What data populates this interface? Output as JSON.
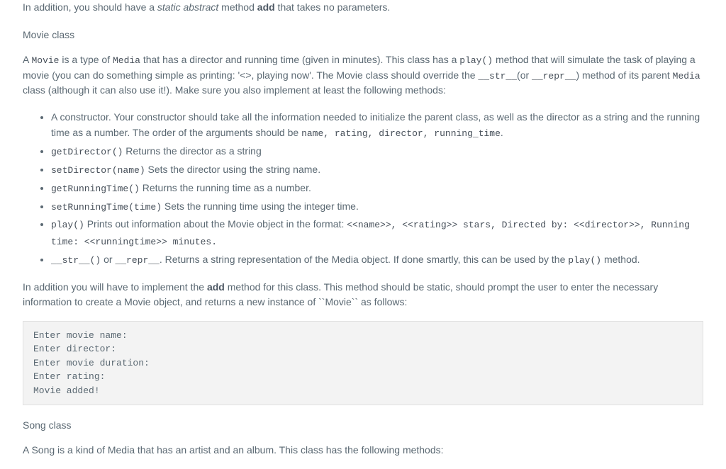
{
  "intro_line": "In addition, you should have a static abstract method add that takes no parameters.",
  "movie": {
    "heading": "Movie class",
    "p1": {
      "t0": "A ",
      "c0": "Movie",
      "t1": " is a type of ",
      "c1": "Media",
      "t2": " that has a director and running time (given in minutes). This class has a ",
      "c2": "play()",
      "t3": " method that will simulate the task of playing a movie (you can do something simple as printing: '<>, playing now'. The Movie class should override the ",
      "c3": "__str__",
      "t4": "(or ",
      "c4": "__repr__",
      "t5": ") method of its parent ",
      "c5": "Media",
      "t6": " class (although it can also use it!). Make sure you also implement at least the following methods:"
    },
    "bullets": [
      {
        "t0": "A constructor. Your constructor should take all the information needed to initialize the parent class, as well as the director as a string and the running time as a number. The order of the arguments should be ",
        "c0": "name, rating, director, running_time",
        "t1": "."
      },
      {
        "c0": "getDirector()",
        "t0": " Returns the director as a string"
      },
      {
        "c0": "setDirector(name)",
        "t0": " Sets the director using the string name."
      },
      {
        "c0": "getRunningTime()",
        "t0": " Returns the running time as a number."
      },
      {
        "c0": "setRunningTime(time)",
        "t0": " Sets the running time using the integer time."
      },
      {
        "c0": "play()",
        "t0": " Prints out information about the Movie object in the format: ",
        "c1": "<<name>>, <<rating>> stars, Directed by: <<director>>, Running time: <<runningtime>> minutes."
      },
      {
        "c0": "__str__()",
        "t0": " or ",
        "c1": "__repr__",
        "t1": ". Returns a string representation of the Media object. If done smartly, this can be used by the ",
        "c2": "play()",
        "t2": " method."
      }
    ],
    "p2": {
      "t0": "In addition you will have to implement the ",
      "b0": "add",
      "t1": " method for this class. This method should be static, should prompt the user to enter the necessary information to create a Movie object, and returns a new instance of ``Movie`` as follows:"
    },
    "code": "Enter movie name:\nEnter director:\nEnter movie duration:\nEnter rating:\nMovie added!"
  },
  "song": {
    "heading": "Song class",
    "p1": "A Song is a kind of Media that has an artist and an album. This class has the following methods:"
  }
}
